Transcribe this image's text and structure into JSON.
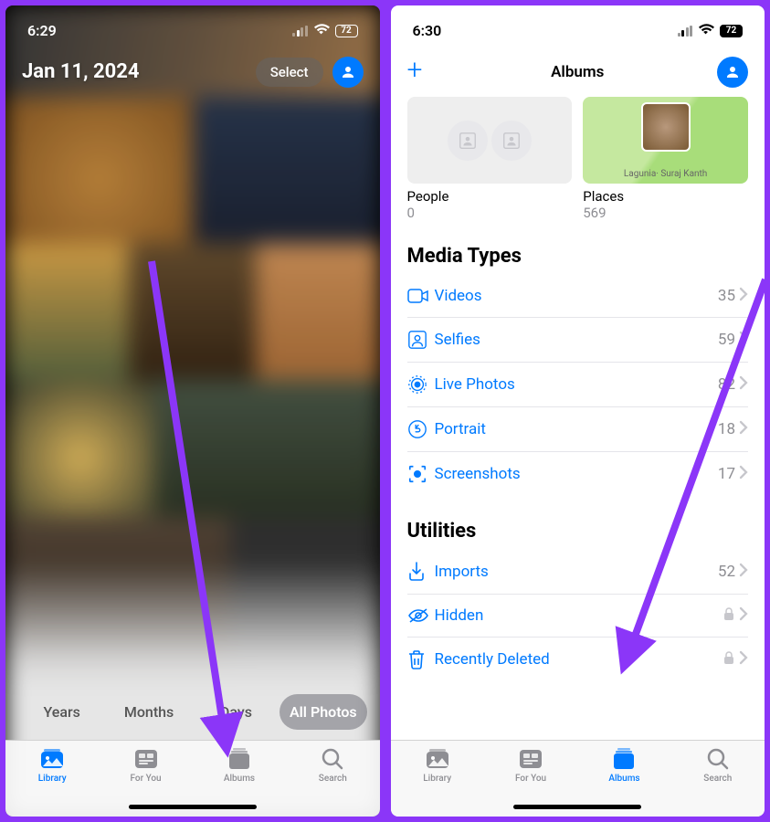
{
  "left": {
    "status": {
      "time": "6:29",
      "battery": "72"
    },
    "header": {
      "date": "Jan 11, 2024",
      "select": "Select"
    },
    "segments": [
      "Years",
      "Months",
      "Days",
      "All Photos"
    ],
    "activeSegment": 3,
    "tabs": [
      {
        "key": "library",
        "label": "Library"
      },
      {
        "key": "foryou",
        "label": "For You"
      },
      {
        "key": "albums",
        "label": "Albums"
      },
      {
        "key": "search",
        "label": "Search"
      }
    ],
    "activeTab": 0
  },
  "right": {
    "status": {
      "time": "6:30",
      "battery": "72"
    },
    "header": {
      "title": "Albums"
    },
    "cards": {
      "people": {
        "label": "People",
        "count": "0"
      },
      "places": {
        "label": "Places",
        "count": "569",
        "map_label": "Lagunia·\nSuraj Kanth"
      }
    },
    "sections": {
      "media": {
        "title": "Media Types",
        "rows": [
          {
            "icon": "video",
            "label": "Videos",
            "count": "35"
          },
          {
            "icon": "selfie",
            "label": "Selfies",
            "count": "59"
          },
          {
            "icon": "live",
            "label": "Live Photos",
            "count": "82"
          },
          {
            "icon": "portrait",
            "label": "Portrait",
            "count": "18"
          },
          {
            "icon": "screenshot",
            "label": "Screenshots",
            "count": "17"
          }
        ]
      },
      "util": {
        "title": "Utilities",
        "rows": [
          {
            "icon": "import",
            "label": "Imports",
            "count": "52",
            "locked": false
          },
          {
            "icon": "hidden",
            "label": "Hidden",
            "locked": true
          },
          {
            "icon": "trash",
            "label": "Recently Deleted",
            "locked": true
          }
        ]
      }
    },
    "tabs": [
      {
        "key": "library",
        "label": "Library"
      },
      {
        "key": "foryou",
        "label": "For You"
      },
      {
        "key": "albums",
        "label": "Albums"
      },
      {
        "key": "search",
        "label": "Search"
      }
    ],
    "activeTab": 2
  }
}
